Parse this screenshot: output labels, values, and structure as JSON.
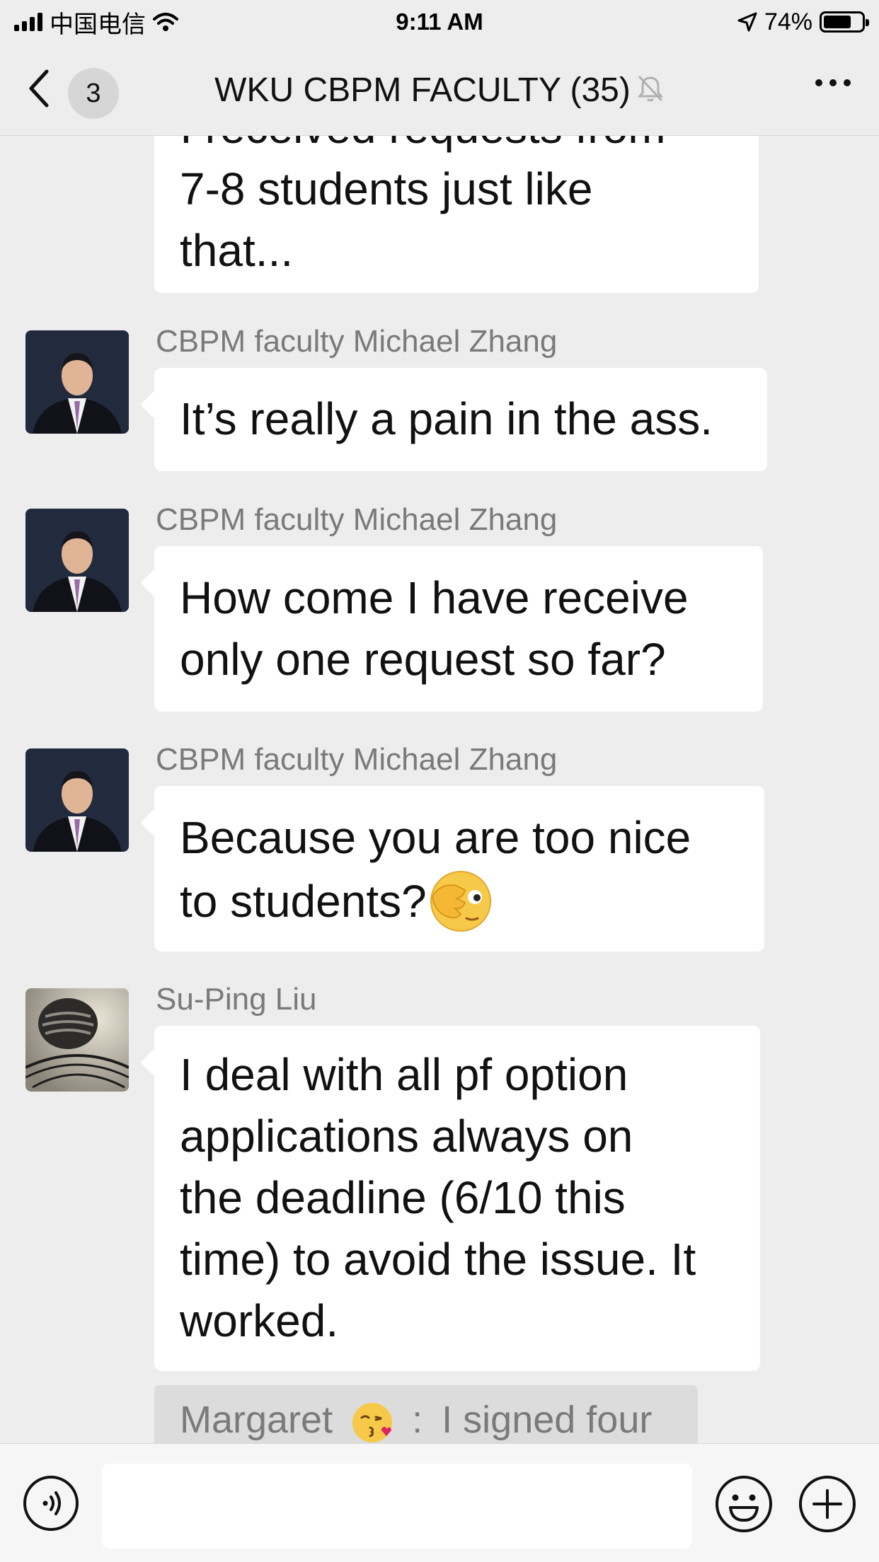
{
  "status_bar": {
    "carrier": "中国电信",
    "time": "9:11 AM",
    "battery": "74%"
  },
  "nav": {
    "unread_count": "3",
    "title": "WKU CBPM FACULTY (35)"
  },
  "messages": [
    {
      "sender": "",
      "lines": [
        "I received requests from",
        "7-8 students just like",
        "that..."
      ]
    },
    {
      "sender": "CBPM faculty Michael Zhang",
      "lines": [
        "It’s really a pain in the ass."
      ]
    },
    {
      "sender": "CBPM faculty Michael Zhang",
      "lines": [
        "How come I have receive",
        "only one request so far?"
      ]
    },
    {
      "sender": "CBPM faculty Michael Zhang",
      "lines": [
        "Because you are too nice",
        "to students?"
      ]
    },
    {
      "sender": "Su-Ping Liu",
      "lines": [
        "I deal with all pf option",
        "applications always on",
        "the deadline (6/10 this",
        "time) to avoid the issue. It",
        "worked."
      ]
    }
  ],
  "quote": {
    "name": "Margaret",
    "separator": ":",
    "text": "I signed four"
  }
}
